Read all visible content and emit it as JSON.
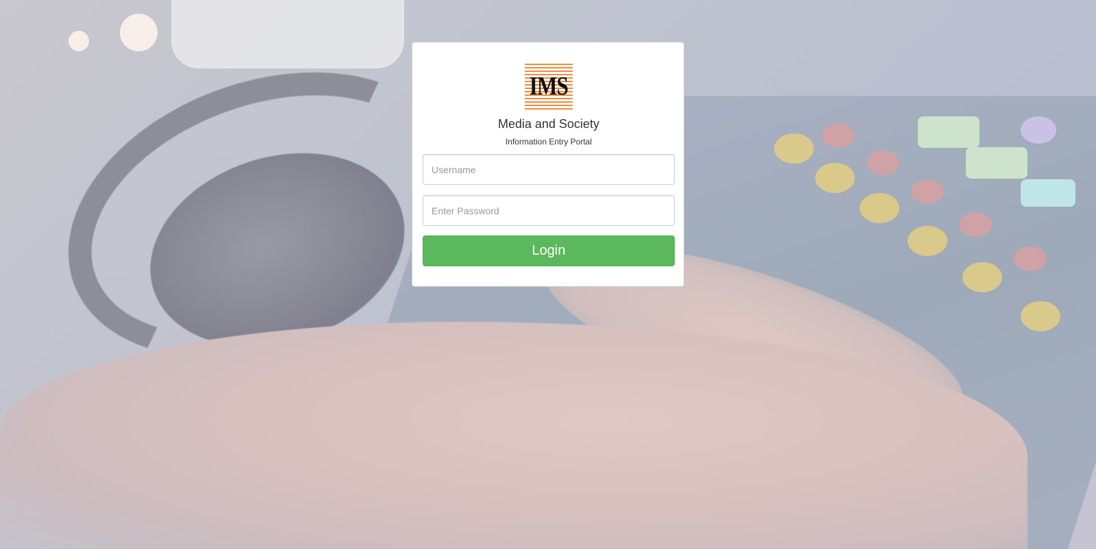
{
  "brand": {
    "logo_text": "IMS",
    "title": "Media and Society",
    "subtitle": "Information Entry Portal",
    "accent_color": "#ef8b3c"
  },
  "form": {
    "username": {
      "placeholder": "Username",
      "value": ""
    },
    "password": {
      "placeholder": "Enter Password",
      "value": ""
    },
    "submit_label": "Login",
    "submit_color": "#5cb85c"
  },
  "background": {
    "description_icon": "audio-mixer-background"
  }
}
